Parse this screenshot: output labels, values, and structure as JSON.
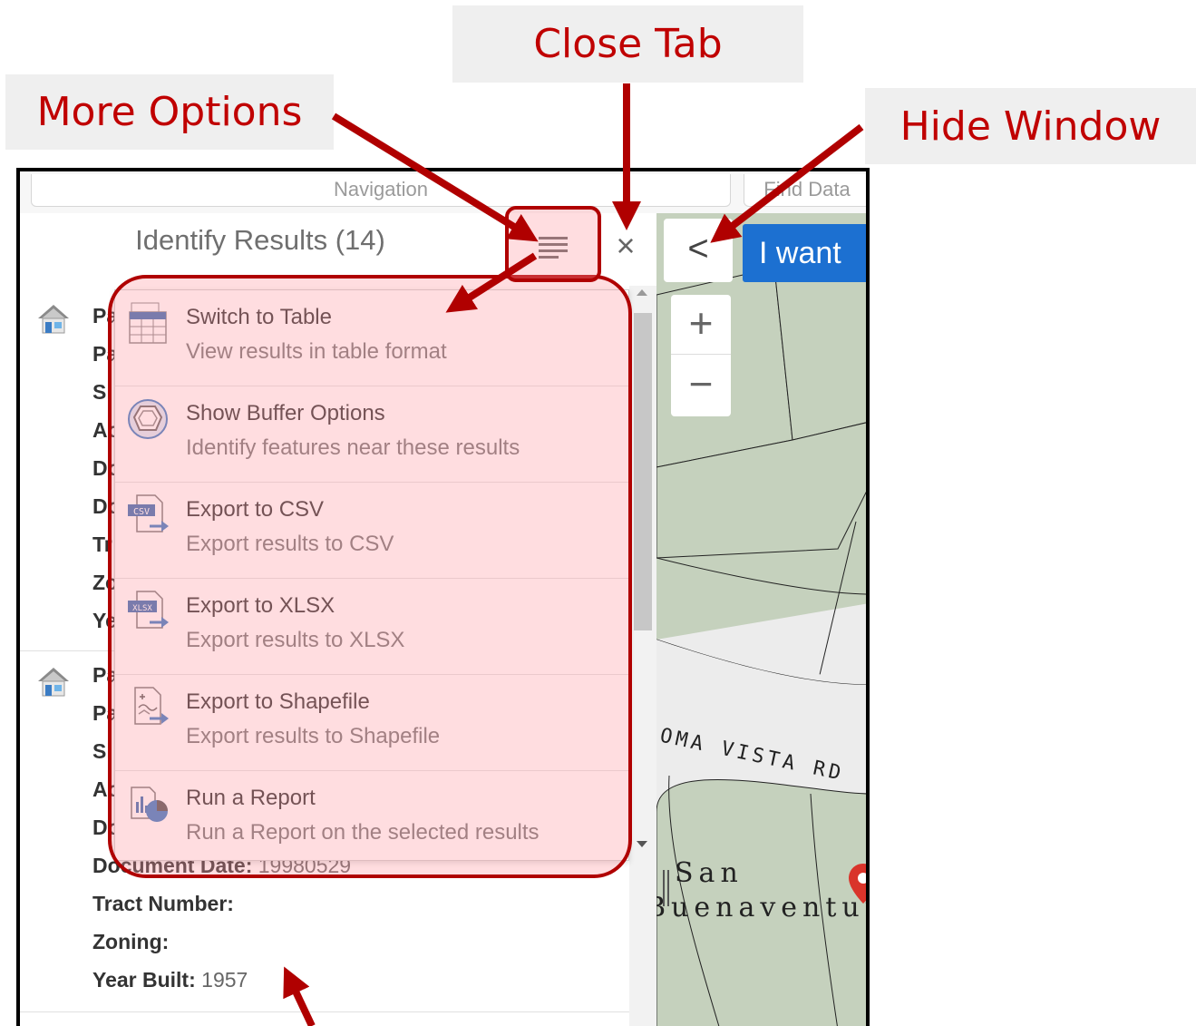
{
  "callouts": {
    "close_tab": "Close Tab",
    "more_options": "More Options",
    "hide_window": "Hide Window"
  },
  "nav": {
    "navigation_label": "Navigation",
    "find_data_label": "Find Data"
  },
  "panel": {
    "title": "Identify Results (14)",
    "close_glyph": "×"
  },
  "results": [
    {
      "field_labels": [
        "Pa",
        "Pa",
        "Si",
        "Ac",
        "Do",
        "Do",
        "Tr",
        "Zo",
        "Ye"
      ]
    },
    {
      "field_labels": [
        "Pa",
        "Pa",
        "Si",
        "Ac",
        "Do"
      ],
      "document_date_label": "Document Date:",
      "document_date_value": "19980529",
      "tract_number_label": "Tract Number:",
      "zoning_label": "Zoning:",
      "year_built_label": "Year Built:",
      "year_built_value": "1957"
    }
  ],
  "menu": {
    "items": [
      {
        "title": "Switch to Table",
        "desc": "View results in table format",
        "icon": "table-icon"
      },
      {
        "title": "Show Buffer Options",
        "desc": "Identify features near these results",
        "icon": "buffer-icon"
      },
      {
        "title": "Export to CSV",
        "desc": "Export results to CSV",
        "icon": "csv-export-icon"
      },
      {
        "title": "Export to XLSX",
        "desc": "Export results to XLSX",
        "icon": "xlsx-export-icon"
      },
      {
        "title": "Export to Shapefile",
        "desc": "Export results to Shapefile",
        "icon": "shapefile-export-icon"
      },
      {
        "title": "Run a Report",
        "desc": "Run a Report on the selected results",
        "icon": "report-icon"
      }
    ]
  },
  "map": {
    "hide_glyph": "<",
    "i_want_label": "I want",
    "zoom_in": "+",
    "zoom_out": "−",
    "street_label": "LOMA VISTA RD",
    "place_label_line1": "San",
    "place_label_line2": "Buenaventura"
  },
  "colors": {
    "callout_text": "#c00000",
    "highlight_border": "#b00000",
    "accent_button": "#1c70d1",
    "parcel_fill": "#c5d1bd"
  }
}
